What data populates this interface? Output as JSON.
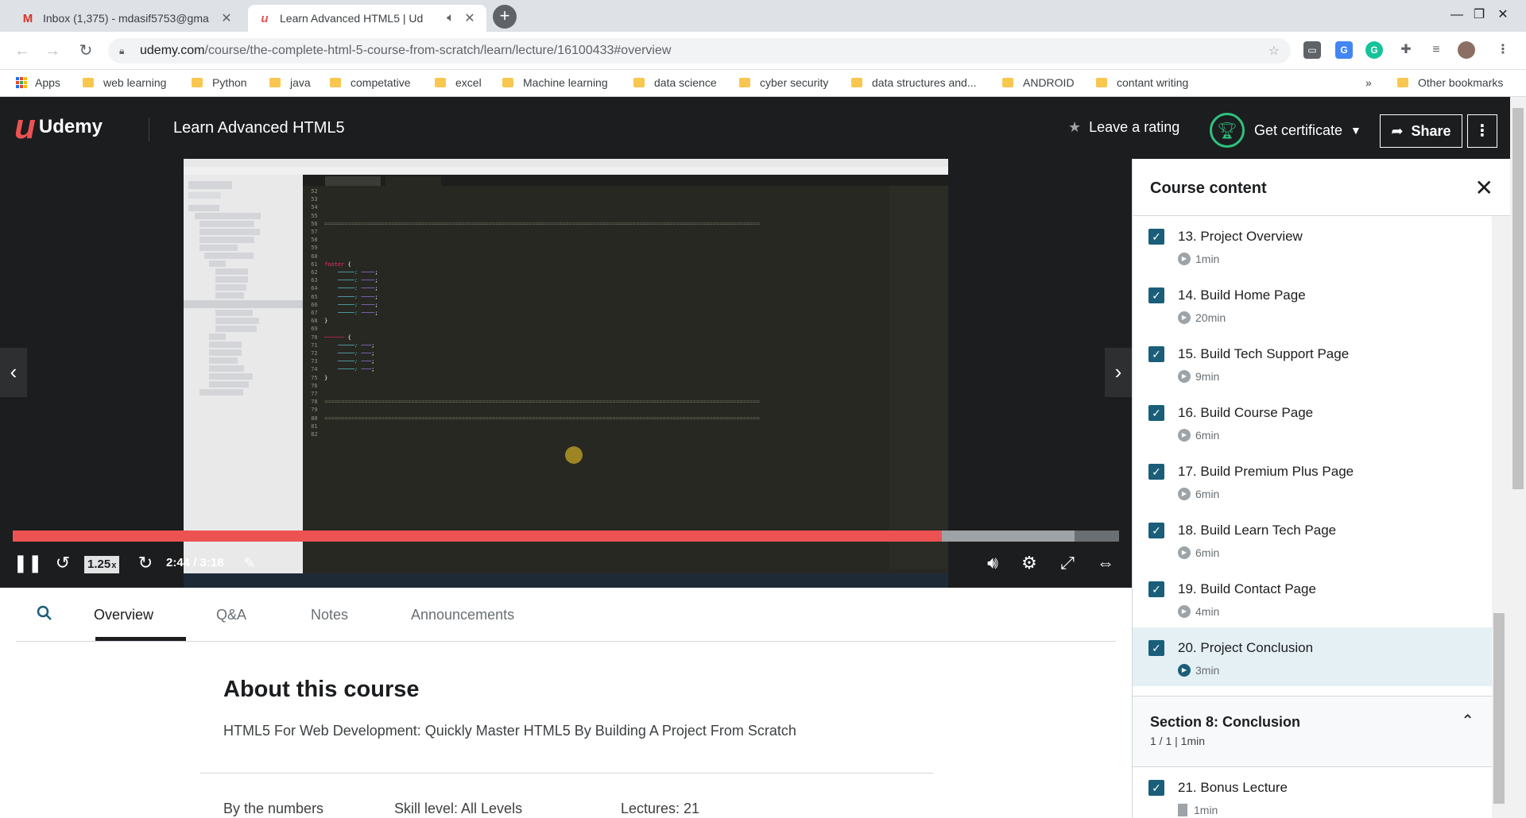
{
  "browser": {
    "tabs": [
      {
        "title": "Inbox (1,375) - mdasif5753@gma",
        "icon": "gmail-icon"
      },
      {
        "title": "Learn Advanced HTML5 | Ud",
        "icon": "udemy-icon"
      }
    ],
    "new_tab_label": "+",
    "url_host": "udemy.com",
    "url_path": "/course/the-complete-html-5-course-from-scratch/learn/lecture/16100433#overview",
    "bookmarks": [
      "web learning",
      "Python",
      "java",
      "competative",
      "excel",
      "Machine learning",
      "data science",
      "cyber security",
      "data structures and...",
      "ANDROID",
      "contant writing"
    ],
    "apps_label": "Apps",
    "overflow_label": "»",
    "other_bookmarks": "Other bookmarks"
  },
  "header": {
    "brand": "Udemy",
    "course_title": "Learn Advanced HTML5",
    "rating_label": "Leave a rating",
    "certificate_label": "Get certificate",
    "share_label": "Share"
  },
  "player": {
    "speed": "1.25",
    "speed_suffix": "x",
    "time_current": "2:44",
    "time_total": "3:18",
    "progress_played": 0.84,
    "progress_buffered": 0.96,
    "accent": "#ec5252"
  },
  "lower_tabs": [
    "Overview",
    "Q&A",
    "Notes",
    "Announcements"
  ],
  "about": {
    "title": "About this course",
    "subtitle": "HTML5 For Web Development: Quickly Master HTML5 By Building A Project From Scratch",
    "stats": [
      "By the numbers",
      "Skill level: All Levels",
      "Lectures: 21"
    ]
  },
  "sidebar": {
    "title": "Course content",
    "lectures": [
      {
        "title": "13. Project Overview",
        "duration": "1min",
        "checked": true
      },
      {
        "title": "14. Build Home Page",
        "duration": "20min",
        "checked": true
      },
      {
        "title": "15. Build Tech Support Page",
        "duration": "9min",
        "checked": true
      },
      {
        "title": "16. Build Course Page",
        "duration": "6min",
        "checked": true
      },
      {
        "title": "17. Build Premium Plus Page",
        "duration": "6min",
        "checked": true
      },
      {
        "title": "18. Build Learn Tech Page",
        "duration": "6min",
        "checked": true
      },
      {
        "title": "19. Build Contact Page",
        "duration": "4min",
        "checked": true
      },
      {
        "title": "20. Project Conclusion",
        "duration": "3min",
        "checked": true,
        "current": true
      }
    ],
    "section": {
      "title": "Section 8: Conclusion",
      "meta": "1 / 1 | 1min"
    },
    "section_lectures": [
      {
        "title": "21. Bonus Lecture",
        "duration": "1min",
        "checked": true,
        "type": "article"
      }
    ]
  }
}
